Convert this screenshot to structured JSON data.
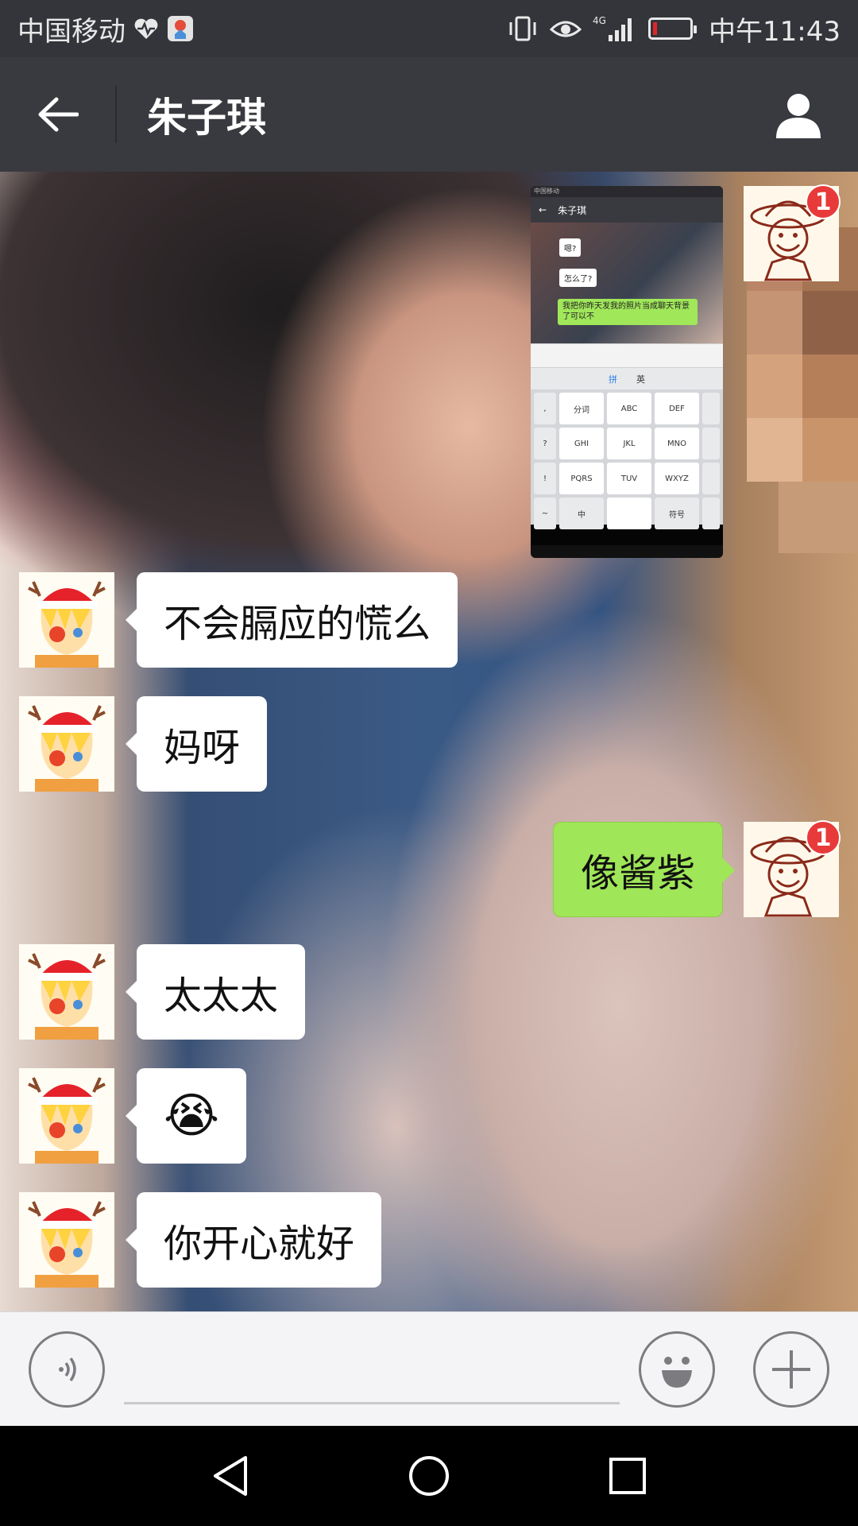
{
  "status_bar": {
    "carrier": "中国移动",
    "time": "中午11:43",
    "network": "4G",
    "battery_level": 0.12,
    "icons": [
      "heart-rate-icon",
      "app-notification-icon",
      "vibrate-icon",
      "eye-icon",
      "signal-icon",
      "battery-icon"
    ]
  },
  "header": {
    "title": "朱子琪",
    "back_icon": "arrow-left-icon",
    "profile_icon": "person-icon"
  },
  "messages": [
    {
      "type": "image",
      "side": "right",
      "badge": "1",
      "description_icon": "chat-screenshot-image"
    },
    {
      "type": "text",
      "side": "left",
      "text": "不会膈应的慌么"
    },
    {
      "type": "text",
      "side": "left",
      "text": "妈呀"
    },
    {
      "type": "text",
      "side": "right",
      "text": "像酱紫",
      "badge": "1"
    },
    {
      "type": "text",
      "side": "left",
      "text": "太太太"
    },
    {
      "type": "text",
      "side": "left",
      "text": "😭"
    },
    {
      "type": "text",
      "side": "left",
      "text": "你开心就好"
    }
  ],
  "embedded_screenshot": {
    "status_text": "中国移动",
    "title": "朱子琪",
    "bubbles": [
      "嗯?",
      "怎么了?",
      "我把你昨天发我的照片当成聊天背景了可以不"
    ],
    "keys": [
      "分词",
      "ABC",
      "DEF",
      "GHI",
      "JKL",
      "MNO",
      "PQRS",
      "TUV",
      "WXYZ",
      "中",
      "符号"
    ],
    "side_keys": [
      ",",
      ".",
      "?",
      "!",
      "~"
    ],
    "top_bar_keys": [
      "拼",
      "英"
    ]
  },
  "input_bar": {
    "voice_icon": "voice-icon",
    "emoji_icon": "smiley-icon",
    "more_icon": "plus-icon",
    "input_value": ""
  },
  "nav_bar": {
    "icons": [
      "back-triangle-icon",
      "home-circle-icon",
      "recents-square-icon"
    ]
  }
}
